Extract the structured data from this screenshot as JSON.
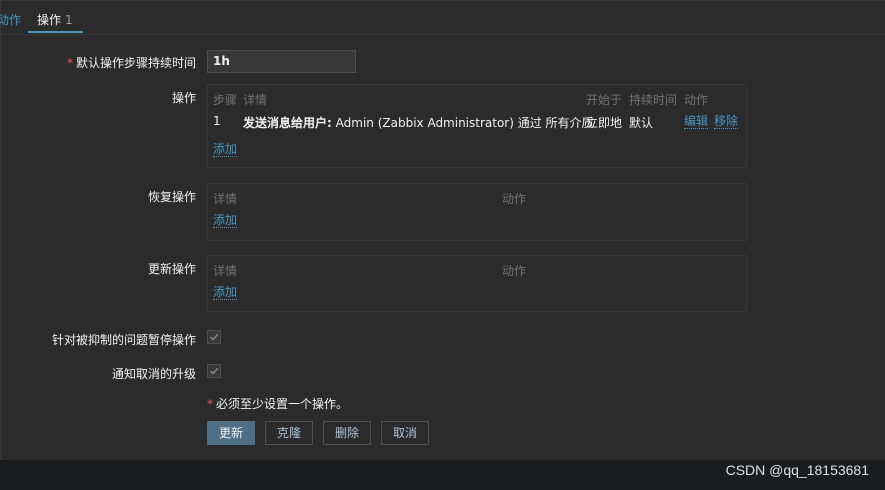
{
  "tabs": {
    "action_label": "动作",
    "operations_label": "操作",
    "operations_count": "1"
  },
  "form": {
    "default_duration": {
      "required_mark": "*",
      "label": "默认操作步骤持续时间",
      "value": "1h"
    },
    "operations": {
      "label": "操作",
      "columns": [
        "步骤",
        "详情",
        "开始于",
        "持续时间",
        "动作"
      ],
      "rows": [
        {
          "step": "1",
          "details_bold": "发送消息给用户:",
          "details_rest": "Admin (Zabbix Administrator) 通过 所有介质",
          "start_in": "立即地",
          "duration": "默认",
          "edit": "编辑",
          "remove": "移除"
        }
      ],
      "add": "添加"
    },
    "recovery_operations": {
      "label": "恢复操作",
      "columns": [
        "详情",
        "动作"
      ],
      "add": "添加"
    },
    "update_operations": {
      "label": "更新操作",
      "columns": [
        "详情",
        "动作"
      ],
      "add": "添加"
    },
    "pause_suppressed": {
      "label": "针对被抑制的问题暂停操作",
      "checked": true
    },
    "notify_canceled": {
      "label": "通知取消的升级",
      "checked": true
    },
    "required_note": {
      "mark": "*",
      "text": "必须至少设置一个操作。"
    }
  },
  "buttons": {
    "update": "更新",
    "clone": "克隆",
    "delete": "删除",
    "cancel": "取消"
  },
  "watermark": "CSDN @qq_18153681",
  "colors": {
    "link": "#4796c4",
    "primary_button": "#4f6f87",
    "required": "#e45959",
    "background": "#2b2b2b"
  }
}
